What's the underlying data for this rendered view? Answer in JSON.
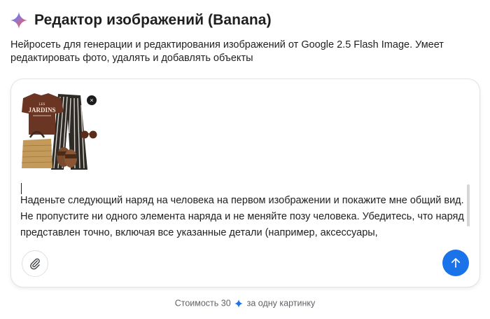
{
  "header": {
    "title": "Редактор изображений (Banana)",
    "logo_icon": "gemini-sparkle-icon"
  },
  "description": "Нейросеть для генерации и редактирования изображений от Google 2.5 Flash Image. Умеет редактировать фото, удалять и добавлять объекты",
  "attachment": {
    "close_label": "×",
    "thumb_shirt_text": "LES JARDINS"
  },
  "prompt": {
    "text": "Наденьте следующий наряд на человека на первом изображении и покажите мне общий вид. Не пропустите ни одного элемента наряда и не меняйте позу человека. Убедитесь, что наряд представлен точно, включая все указанные детали (например, аксессуары,"
  },
  "buttons": {
    "attach_icon": "paperclip-icon",
    "send_icon": "arrow-up-icon"
  },
  "footer": {
    "prefix": "Стоимость 30",
    "suffix": "за одну картинку",
    "icon": "sparkle-icon"
  },
  "colors": {
    "accent": "#1a73e8",
    "text": "#1f1f1f",
    "muted": "#5f6368"
  }
}
